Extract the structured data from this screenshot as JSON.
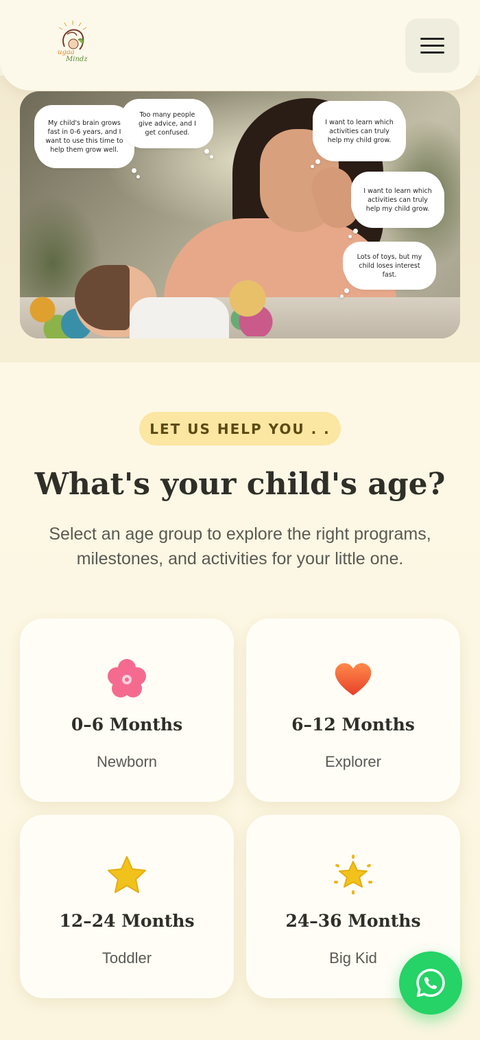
{
  "header": {
    "logo_line1": "ugaa",
    "logo_line2": "Mindz",
    "menu_icon": "hamburger-menu-icon"
  },
  "hero": {
    "bubbles": [
      "My child's brain grows fast in 0-6 years, and I want to use this time to help them grow well.",
      "Too many people give advice, and I get confused.",
      "I want to learn which activities can truly help my child grow.",
      "I want to learn which activities can truly help my child grow.",
      "Lots of toys, but my child loses interest fast."
    ]
  },
  "section": {
    "badge": "LET US HELP YOU . .",
    "title": "What's your child's age?",
    "subtitle": "Select an age group to explore the right programs, milestones, and activities for your little one."
  },
  "age_groups": [
    {
      "range": "0–6 Months",
      "label": "Newborn",
      "icon": "flower-icon",
      "color": "#f46b8f"
    },
    {
      "range": "6–12 Months",
      "label": "Explorer",
      "icon": "heart-icon",
      "color": "#f4573a"
    },
    {
      "range": "12–24 Months",
      "label": "Toddler",
      "icon": "star-icon",
      "color": "#f2c21c"
    },
    {
      "range": "24–36 Months",
      "label": "Big Kid",
      "icon": "sparkle-star-icon",
      "color": "#f2c21c"
    }
  ],
  "whatsapp": {
    "icon": "whatsapp-icon",
    "color": "#25d366"
  }
}
